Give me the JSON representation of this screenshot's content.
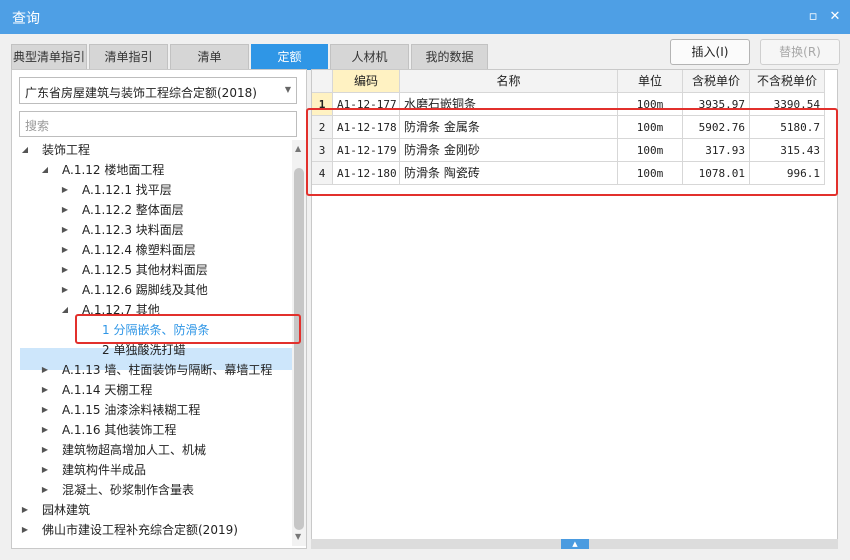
{
  "window": {
    "title": "查询",
    "min_label": "▫",
    "close_label": "✕"
  },
  "tabs": [
    {
      "label": "典型清单指引"
    },
    {
      "label": "清单指引"
    },
    {
      "label": "清单"
    },
    {
      "label": "定额",
      "active": true
    },
    {
      "label": "人材机"
    },
    {
      "label": "我的数据"
    }
  ],
  "buttons": {
    "insert": "插入(I)",
    "replace": "替换(R)"
  },
  "left": {
    "library": "广东省房屋建筑与装饰工程综合定额(2018)",
    "search_placeholder": "搜索",
    "tree": [
      {
        "label": "装饰工程",
        "toggle": "◢"
      },
      {
        "label": "A.1.12 楼地面工程",
        "toggle": "◢"
      },
      {
        "label": "A.1.12.1 找平层",
        "toggle": "▶"
      },
      {
        "label": "A.1.12.2 整体面层",
        "toggle": "▶"
      },
      {
        "label": "A.1.12.3 块料面层",
        "toggle": "▶"
      },
      {
        "label": "A.1.12.4 橡塑料面层",
        "toggle": "▶"
      },
      {
        "label": "A.1.12.5 其他材料面层",
        "toggle": "▶"
      },
      {
        "label": "A.1.12.6 踢脚线及其他",
        "toggle": "▶"
      },
      {
        "label": "A.1.12.7 其他",
        "toggle": "◢"
      },
      {
        "label": "1 分隔嵌条、防滑条",
        "toggle": "",
        "selected": true
      },
      {
        "label": "2 单独酸洗打蜡",
        "toggle": ""
      },
      {
        "label": "A.1.13 墙、柱面装饰与隔断、幕墙工程",
        "toggle": "▶"
      },
      {
        "label": "A.1.14 天棚工程",
        "toggle": "▶"
      },
      {
        "label": "A.1.15 油漆涂料裱糊工程",
        "toggle": "▶"
      },
      {
        "label": "A.1.16 其他装饰工程",
        "toggle": "▶"
      },
      {
        "label": "建筑物超高增加人工、机械",
        "toggle": "▶"
      },
      {
        "label": "建筑构件半成品",
        "toggle": "▶"
      },
      {
        "label": "混凝土、砂浆制作含量表",
        "toggle": "▶"
      },
      {
        "label": "园林建筑",
        "toggle": "▶"
      },
      {
        "label": "佛山市建设工程补充综合定额(2019)",
        "toggle": "▶"
      }
    ]
  },
  "table": {
    "headers": [
      "编码",
      "名称",
      "单位",
      "含税单价",
      "不含税单价"
    ],
    "rows": [
      {
        "no": "1",
        "code": "A1-12-177",
        "name": "水磨石嵌铜条",
        "unit": "100m",
        "price_tax": "3935.97",
        "price_notax": "3390.54"
      },
      {
        "no": "2",
        "code": "A1-12-178",
        "name": "防滑条 金属条",
        "unit": "100m",
        "price_tax": "5902.76",
        "price_notax": "5180.7"
      },
      {
        "no": "3",
        "code": "A1-12-179",
        "name": "防滑条 金刚砂",
        "unit": "100m",
        "price_tax": "317.93",
        "price_notax": "315.43"
      },
      {
        "no": "4",
        "code": "A1-12-180",
        "name": "防滑条 陶瓷砖",
        "unit": "100m",
        "price_tax": "1078.01",
        "price_notax": "996.1"
      }
    ]
  },
  "colors": {
    "titlebar": "#4e9fe5",
    "active_tab": "#2f96e6",
    "highlight_box": "#e2302c",
    "selection": "#cde6fb"
  }
}
